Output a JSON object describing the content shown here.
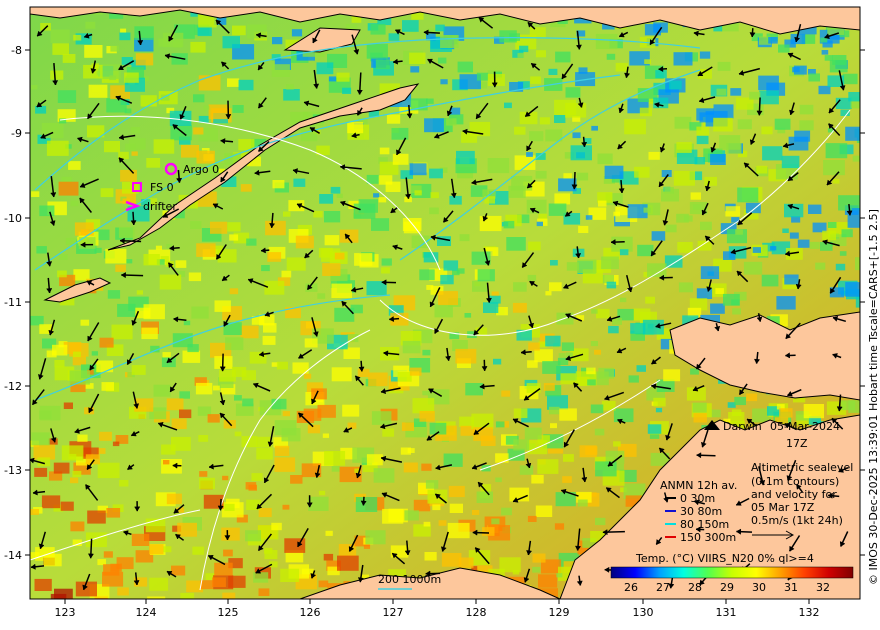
{
  "map": {
    "date_line1": "05-Mar-2024",
    "date_line2": "17Z",
    "city": "Darwin",
    "side_caption": "© IMOS 30-Dec-2025 13:39:01 Hobart time Tscale=CARS+[-1.5 2.5]",
    "x_ticks": [
      "123",
      "124",
      "125",
      "126",
      "127",
      "128",
      "129",
      "130",
      "131",
      "132"
    ],
    "y_ticks": [
      "8",
      "9",
      "10",
      "11",
      "12",
      "13",
      "14"
    ],
    "argo_label": "Argo 0",
    "fs_label": "FS 0",
    "drifter_label": "drifter",
    "anmn_title": "ANMN 12h av.",
    "anmn_rows": [
      {
        "label": "0 30m",
        "color": "#000000"
      },
      {
        "label": "30 80m",
        "color": "#1010d0"
      },
      {
        "label": "80 150m",
        "color": "#00e0e0"
      },
      {
        "label": "150 300m",
        "color": "#e00000"
      }
    ],
    "altimetry_lines": [
      "Altimetric sealevel",
      "(0.1m contours)",
      "and velocity for",
      "05 Mar 17Z",
      "0.5m/s (1kt 24h)"
    ],
    "contour_label": "200  1000m",
    "colorbar_title": "Temp. (°C) VIIRS_N20 0% ql>=4",
    "colorbar_ticks": [
      "26",
      "27",
      "28",
      "29",
      "30",
      "31",
      "32"
    ],
    "colors": {
      "land": "#fdc79c",
      "accent_magenta": "#ff00ff",
      "bathy_cyan": "#40d0e0"
    },
    "colorbar_stops": [
      "#00007f",
      "#0000ff",
      "#00a0ff",
      "#00ffe0",
      "#50ff50",
      "#c8ff00",
      "#ffff00",
      "#ffa000",
      "#ff4000",
      "#d00000",
      "#800000"
    ]
  }
}
